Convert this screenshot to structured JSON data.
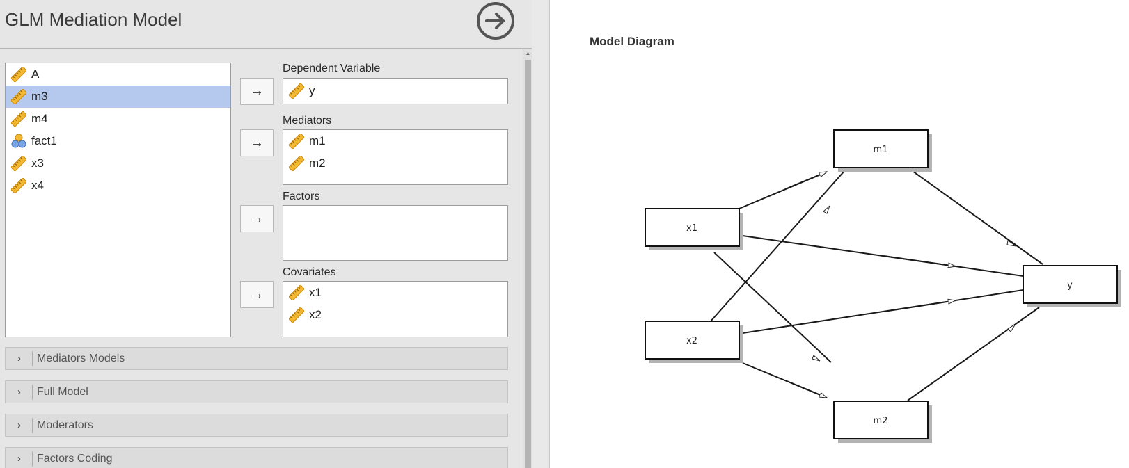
{
  "title": "GLM Mediation Model",
  "variables": [
    {
      "name": "A",
      "type": "scale",
      "selected": false
    },
    {
      "name": "m3",
      "type": "scale",
      "selected": true
    },
    {
      "name": "m4",
      "type": "scale",
      "selected": false
    },
    {
      "name": "fact1",
      "type": "nominal",
      "selected": false
    },
    {
      "name": "x3",
      "type": "scale",
      "selected": false
    },
    {
      "name": "x4",
      "type": "scale",
      "selected": false
    }
  ],
  "dependent": {
    "label": "Dependent Variable",
    "items": [
      {
        "name": "y",
        "type": "scale"
      }
    ]
  },
  "mediators": {
    "label": "Mediators",
    "items": [
      {
        "name": "m1",
        "type": "scale"
      },
      {
        "name": "m2",
        "type": "scale"
      }
    ]
  },
  "factors": {
    "label": "Factors",
    "items": []
  },
  "covariates": {
    "label": "Covariates",
    "items": [
      {
        "name": "x1",
        "type": "scale"
      },
      {
        "name": "x2",
        "type": "scale"
      }
    ]
  },
  "sections": [
    {
      "label": "Mediators Models"
    },
    {
      "label": "Full Model"
    },
    {
      "label": "Moderators"
    },
    {
      "label": "Factors Coding"
    }
  ],
  "results": {
    "diagram_title": "Model Diagram",
    "nodes": {
      "x1": "x1",
      "x2": "x2",
      "m1": "m1",
      "m2": "m2",
      "y": "y"
    }
  },
  "icons": {
    "scale": "ruler-icon",
    "nominal": "nominal-circles-icon",
    "run": "arrow-right-circle-icon",
    "move": "arrow-right-icon"
  }
}
